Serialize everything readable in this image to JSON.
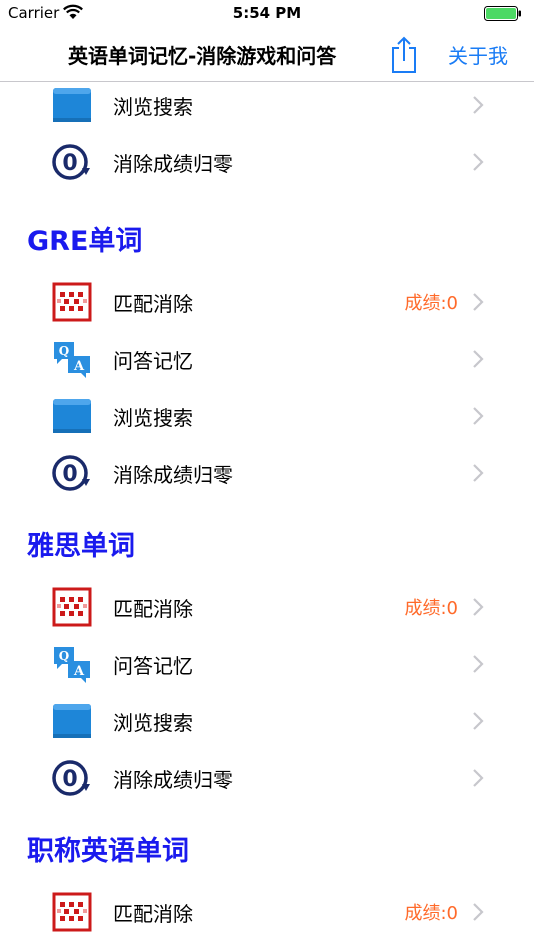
{
  "status_bar": {
    "carrier": "Carrier",
    "time": "5:54 PM",
    "wifi_icon": "wifi-icon",
    "battery_icon": "battery-icon"
  },
  "nav": {
    "title": "英语单词记忆-消除游戏和问答",
    "share_icon": "share-icon",
    "about": "关于我"
  },
  "colors": {
    "accent": "#1a7cf5",
    "section_header": "#1a1aee",
    "score": "#ff6a2a",
    "match_icon": "#cc1a1a",
    "qa_icon": "#2a8fe0",
    "browse_icon": "#1e86d8",
    "reset_icon": "#1a2a6a"
  },
  "top_rows": [
    {
      "label": "浏览搜索",
      "icon": "book-icon"
    },
    {
      "label": "消除成绩归零",
      "icon": "reset-score-icon"
    }
  ],
  "sections": [
    {
      "title": "GRE单词",
      "rows": [
        {
          "label": "匹配消除",
          "score": "成绩:0",
          "icon": "match-grid-icon"
        },
        {
          "label": "问答记忆",
          "icon": "qa-icon"
        },
        {
          "label": "浏览搜索",
          "icon": "book-icon"
        },
        {
          "label": "消除成绩归零",
          "icon": "reset-score-icon"
        }
      ]
    },
    {
      "title": "雅思单词",
      "rows": [
        {
          "label": "匹配消除",
          "score": "成绩:0",
          "icon": "match-grid-icon"
        },
        {
          "label": "问答记忆",
          "icon": "qa-icon"
        },
        {
          "label": "浏览搜索",
          "icon": "book-icon"
        },
        {
          "label": "消除成绩归零",
          "icon": "reset-score-icon"
        }
      ]
    },
    {
      "title": "职称英语单词",
      "rows": [
        {
          "label": "匹配消除",
          "score": "成绩:0",
          "icon": "match-grid-icon"
        }
      ]
    }
  ]
}
